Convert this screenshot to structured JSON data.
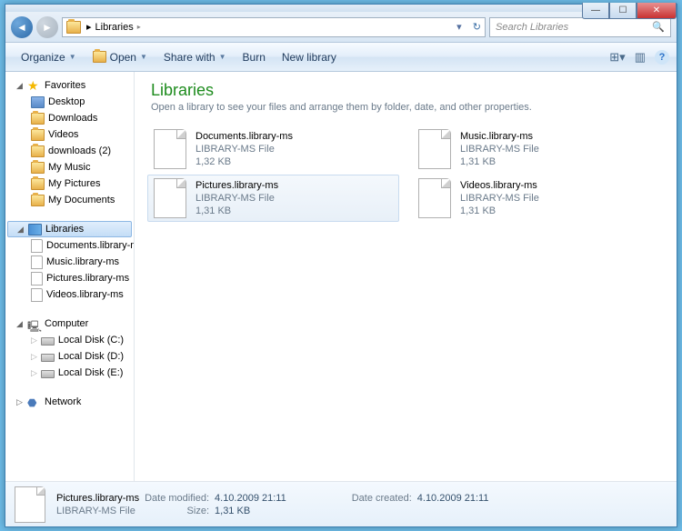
{
  "address": {
    "location": "Libraries",
    "separator": "▸"
  },
  "search": {
    "placeholder": "Search Libraries"
  },
  "toolbar": {
    "organize": "Organize",
    "open": "Open",
    "share": "Share with",
    "burn": "Burn",
    "newlib": "New library"
  },
  "nav": {
    "favorites": {
      "label": "Favorites",
      "items": [
        "Desktop",
        "Downloads",
        "Videos",
        "downloads (2)",
        "My Music",
        "My Pictures",
        "My Documents"
      ]
    },
    "libraries": {
      "label": "Libraries",
      "items": [
        "Documents.library-m",
        "Music.library-ms",
        "Pictures.library-ms",
        "Videos.library-ms"
      ]
    },
    "computer": {
      "label": "Computer",
      "items": [
        "Local Disk (C:)",
        "Local Disk (D:)",
        "Local Disk (E:)"
      ]
    },
    "network": {
      "label": "Network"
    }
  },
  "page": {
    "title": "Libraries",
    "subtitle": "Open a library to see your files and arrange them by folder, date, and other properties."
  },
  "files": [
    {
      "name": "Documents.library-ms",
      "type": "LIBRARY-MS File",
      "size": "1,32 KB"
    },
    {
      "name": "Music.library-ms",
      "type": "LIBRARY-MS File",
      "size": "1,31 KB"
    },
    {
      "name": "Pictures.library-ms",
      "type": "LIBRARY-MS File",
      "size": "1,31 KB"
    },
    {
      "name": "Videos.library-ms",
      "type": "LIBRARY-MS File",
      "size": "1,31 KB"
    }
  ],
  "status": {
    "name": "Pictures.library-ms",
    "type": "LIBRARY-MS File",
    "modified_label": "Date modified:",
    "modified": "4.10.2009 21:11",
    "size_label": "Size:",
    "size": "1,31 KB",
    "created_label": "Date created:",
    "created": "4.10.2009 21:11"
  }
}
